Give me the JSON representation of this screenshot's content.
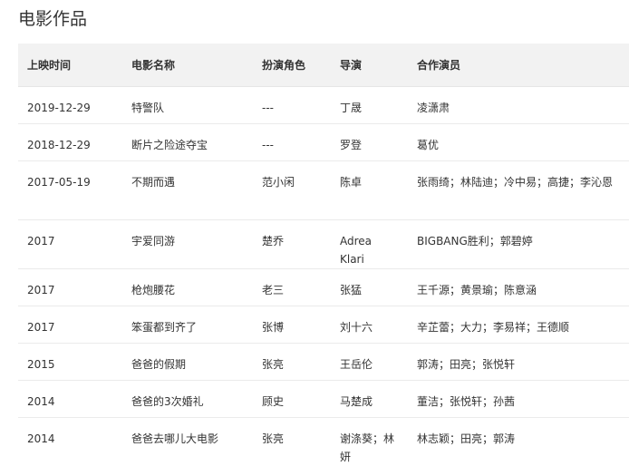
{
  "section": {
    "title": "电影作品"
  },
  "table": {
    "headers": {
      "date": "上映时间",
      "title": "电影名称",
      "role": "扮演角色",
      "director": "导演",
      "cast": "合作演员"
    },
    "rows": [
      {
        "date": "2019-12-29",
        "title": "特警队",
        "role": "---",
        "director": "丁晟",
        "cast": "凌潇肃"
      },
      {
        "date": "2018-12-29",
        "title": "断片之险途夺宝",
        "role": "---",
        "director": "罗登",
        "cast": "葛优"
      },
      {
        "date": "2017-05-19",
        "title": "不期而遇",
        "role": "范小闲",
        "director": "陈卓",
        "cast": "张雨绮；林陆迪；冷中易；高捷；李沁恩"
      },
      {
        "date": "2017",
        "title": "宇爱同游",
        "role": "楚乔",
        "director": "Adrea Klari",
        "cast": "BIGBANG胜利；郭碧婷"
      },
      {
        "date": "2017",
        "title": "枪炮腰花",
        "role": "老三",
        "director": "张猛",
        "cast": "王千源；黄景瑜；陈意涵"
      },
      {
        "date": "2017",
        "title": "笨蛋都到齐了",
        "role": "张博",
        "director": "刘十六",
        "cast": "辛芷蕾；大力；李易祥；王德顺"
      },
      {
        "date": "2015",
        "title": "爸爸的假期",
        "role": "张亮",
        "director": "王岳伦",
        "cast": "郭涛；田亮；张悦轩"
      },
      {
        "date": "2014",
        "title": "爸爸的3次婚礼",
        "role": "顾史",
        "director": "马楚成",
        "cast": "董洁；张悦轩；孙茜"
      },
      {
        "date": "2014",
        "title": "爸爸去哪儿大电影",
        "role": "张亮",
        "director": "谢涤葵；林妍",
        "cast": "林志颖；田亮；郭涛"
      }
    ]
  }
}
